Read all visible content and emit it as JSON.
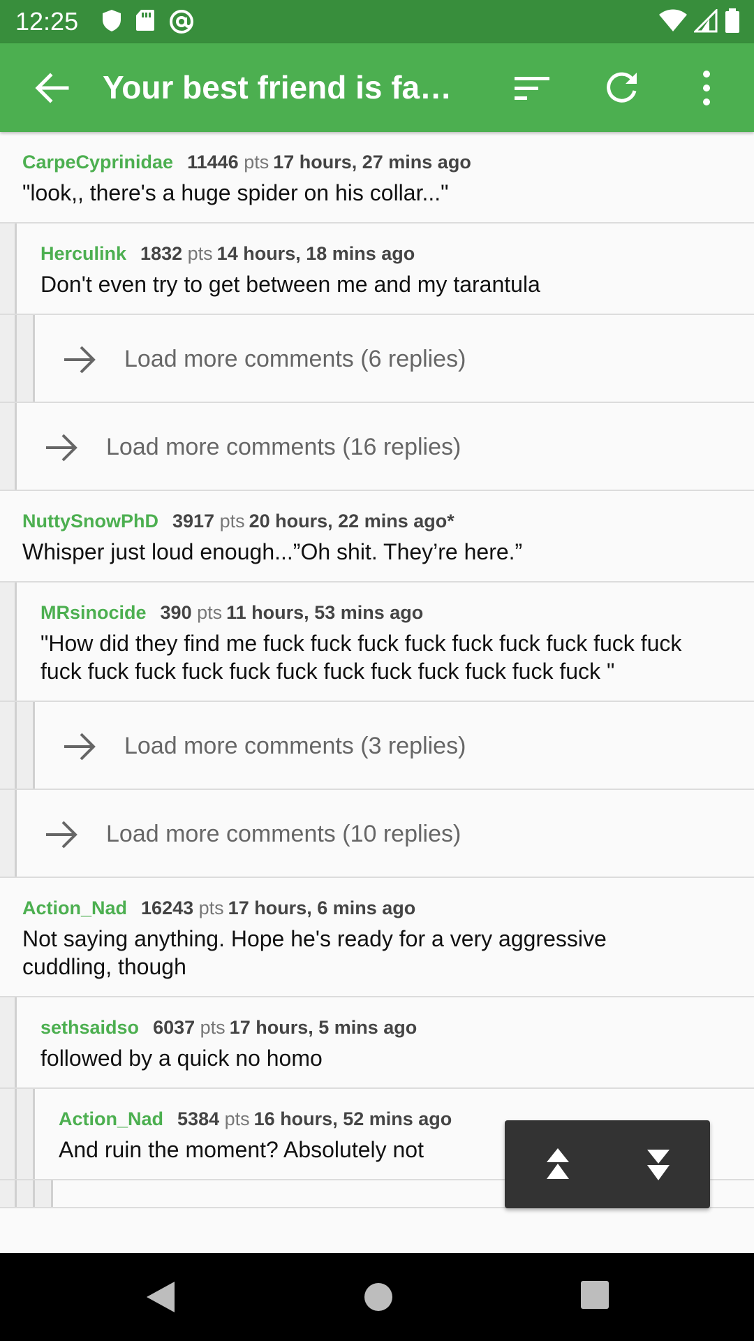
{
  "status_bar": {
    "time": "12:25",
    "icons_left": [
      "shield-icon",
      "sd-card-icon",
      "at-sign-icon"
    ],
    "icons_right": [
      "wifi-icon",
      "signal-icon",
      "battery-icon"
    ]
  },
  "app_bar": {
    "title": "Your best friend is faki…",
    "icons": [
      "back-arrow-icon",
      "sort-icon",
      "refresh-icon",
      "overflow-menu-icon"
    ]
  },
  "colors": {
    "status_bar": "#388e3c",
    "app_bar": "#4caf50",
    "author": "#4caf50",
    "background": "#fafafa",
    "nav_panel": "#333333"
  },
  "comments": [
    {
      "author": "CarpeCyprinidae",
      "score": "11446",
      "pts_label": "pts",
      "time": "17 hours, 27 mins ago",
      "body": "\"look,, there's a huge spider on his collar...\""
    },
    {
      "author": "Herculink",
      "score": "1832",
      "pts_label": "pts",
      "time": "14 hours, 18 mins ago",
      "body": "Don't even try to get between me and my tarantula"
    },
    {
      "author": "NuttySnowPhD",
      "score": "3917",
      "pts_label": "pts",
      "time": "20 hours, 22 mins ago*",
      "body": "Whisper just loud enough...”Oh shit. They’re here.”"
    },
    {
      "author": "MRsinocide",
      "score": "390",
      "pts_label": "pts",
      "time": "11 hours, 53 mins ago",
      "body": "\"How did they find me fuck fuck fuck fuck fuck fuck fuck fuck fuck fuck fuck fuck fuck fuck fuck fuck fuck fuck fuck fuck fuck \""
    },
    {
      "author": "Action_Nad",
      "score": "16243",
      "pts_label": "pts",
      "time": "17 hours, 6 mins ago",
      "body": "Not saying anything.  Hope he's ready for a very aggressive cuddling, though"
    },
    {
      "author": "sethsaidso",
      "score": "6037",
      "pts_label": "pts",
      "time": "17 hours, 5 mins ago",
      "body": "followed by a quick no homo"
    },
    {
      "author": "Action_Nad",
      "score": "5384",
      "pts_label": "pts",
      "time": "16 hours, 52 mins ago",
      "body": "And ruin the moment? Absolutely not"
    }
  ],
  "load_more": [
    {
      "label": "Load more comments (6 replies)"
    },
    {
      "label": "Load more comments (16 replies)"
    },
    {
      "label": "Load more comments (3 replies)"
    },
    {
      "label": "Load more comments (10 replies)"
    }
  ],
  "nav_panel": {
    "icons": [
      "scroll-up-icon",
      "scroll-down-icon"
    ]
  },
  "system_nav": {
    "icons": [
      "nav-back-icon",
      "nav-home-icon",
      "nav-recents-icon"
    ]
  }
}
